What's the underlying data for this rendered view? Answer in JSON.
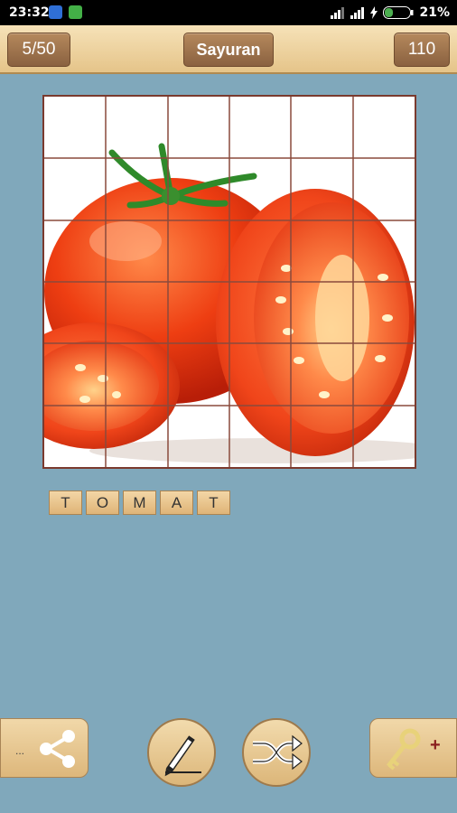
{
  "status_bar": {
    "time": "23:32",
    "battery": "21%"
  },
  "header": {
    "level": "5/50",
    "category": "Sayuran",
    "score": "110"
  },
  "puzzle": {
    "grid_rows": 6,
    "grid_cols": 6,
    "image": "tomato-photo"
  },
  "answer": {
    "letters": [
      "T",
      "O",
      "M",
      "A",
      "T"
    ]
  },
  "controls": {
    "share_dots": "...",
    "hint_plus": "+",
    "icons": [
      "share-icon",
      "pencil-icon",
      "shuffle-icon",
      "key-icon"
    ]
  },
  "colors": {
    "background": "#80a8bb",
    "header": "#e5c489",
    "button_brown": "#8a6140",
    "tile": "#dfb477",
    "grid_border": "#7a3a2e"
  }
}
